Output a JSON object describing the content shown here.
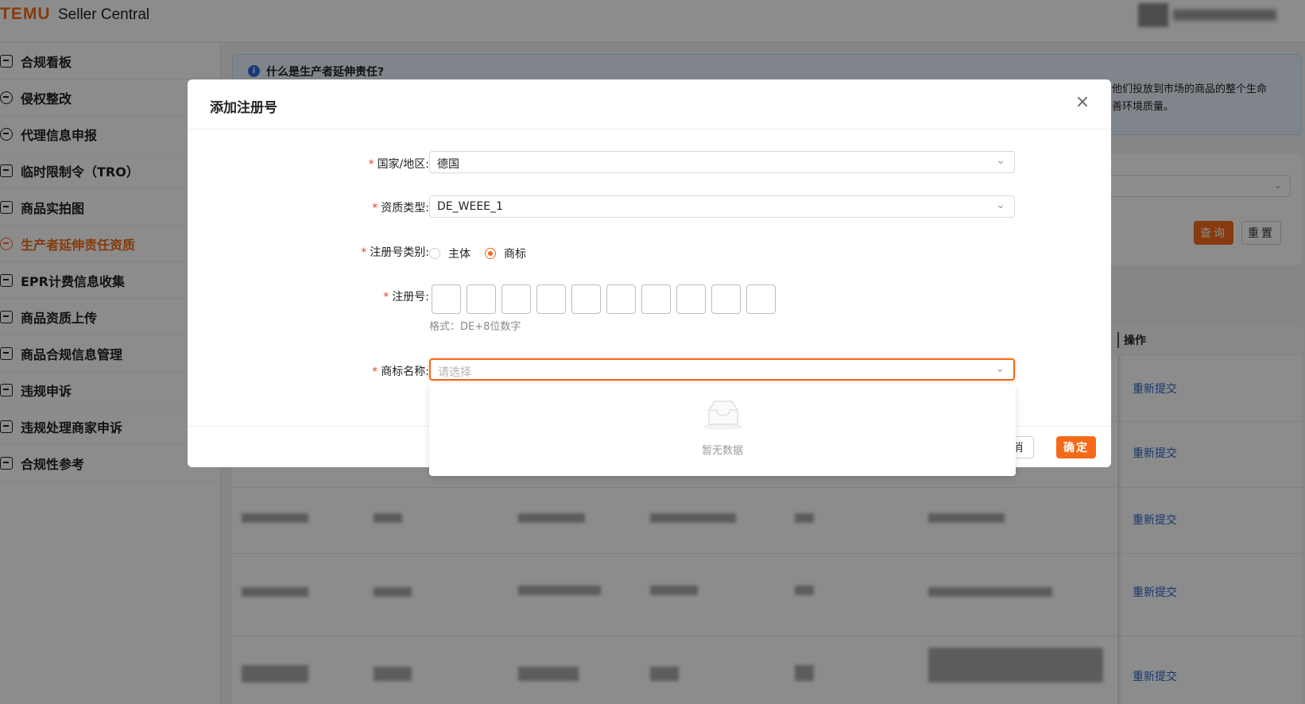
{
  "header": {
    "logo": "TEMU",
    "subtitle": "Seller Central"
  },
  "sidebar": {
    "items": [
      {
        "label": "合规看板",
        "icon": "chart-icon"
      },
      {
        "label": "侵权整改",
        "icon": "shield-icon"
      },
      {
        "label": "代理信息申报",
        "icon": "user-icon"
      },
      {
        "label": "临时限制令（TRO）",
        "icon": "calendar-icon"
      },
      {
        "label": "商品实拍图",
        "icon": "bag-icon"
      },
      {
        "label": "生产者延伸责任资质",
        "icon": "badge-icon",
        "active": true
      },
      {
        "label": "EPR计费信息收集",
        "icon": "document-icon"
      },
      {
        "label": "商品资质上传",
        "icon": "upload-icon"
      },
      {
        "label": "商品合规信息管理",
        "icon": "file-icon"
      },
      {
        "label": "违规申诉",
        "icon": "inbox-icon"
      },
      {
        "label": "违规处理商家申诉",
        "icon": "tray-icon"
      },
      {
        "label": "合规性参考",
        "icon": "book-icon"
      }
    ]
  },
  "notice": {
    "title": "什么是生产者延伸责任?",
    "line1": "他们投放到市场的商品的整个生命",
    "line2": "善环境质量。"
  },
  "filters": {
    "query_label": "查询",
    "reset_label": "重置"
  },
  "table": {
    "ops_header": "操作",
    "row_action": "重新提交"
  },
  "modal": {
    "title": "添加注册号",
    "fields": {
      "country": {
        "label": "国家/地区:",
        "value": "德国"
      },
      "qualification": {
        "label": "资质类型:",
        "value": "DE_WEEE_1"
      },
      "reg_category": {
        "label": "注册号类别:",
        "options": [
          "主体",
          "商标"
        ],
        "selected": "商标"
      },
      "reg_number": {
        "label": "注册号:",
        "hint": "格式：DE+8位数字"
      },
      "brand": {
        "label": "商标名称:",
        "placeholder": "请选择"
      }
    },
    "cancel_label": "取消",
    "ok_label": "确定",
    "dropdown_empty": "暂无数据"
  },
  "colors": {
    "accent": "#f46a18",
    "link": "#2f63c9",
    "required": "#e83a2f"
  }
}
